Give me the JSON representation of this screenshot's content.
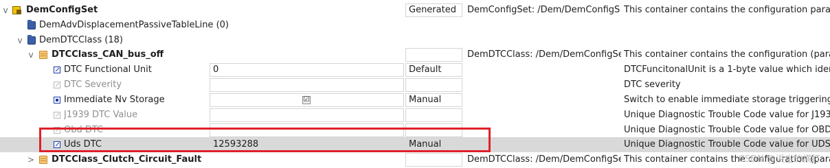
{
  "colors": {
    "selected_row_bg": "#d9d9d9",
    "highlight_border": "#e0202a",
    "param_icon": "#1a3aa8"
  },
  "rows": [
    {
      "label": "DemConfigSet",
      "value": "",
      "option": "Generated",
      "path": "DemConfigSet:  /Dem/DemConfigS",
      "description": "This container contains the configuration param",
      "icon": "config-set-icon",
      "expanded": "v"
    },
    {
      "label": "DemAdvDisplacementPassiveTableLine (0)",
      "icon": "folder-icon"
    },
    {
      "label": "DemDTCClass (18)",
      "icon": "folder-icon",
      "expanded": "v"
    },
    {
      "label": "DTCClass_CAN_bus_off",
      "value": "",
      "option": "",
      "path": "DemDTCClass:  /Dem/DemConfigSe",
      "description": "This container contains the configuration (param",
      "icon": "container-icon",
      "expanded": "v"
    },
    {
      "label": "DTC Functional Unit",
      "value": "0",
      "option": "Default",
      "description": "DTCFuncitonalUnit is a 1-byte value which ident",
      "icon": "parameter-icon"
    },
    {
      "label": "DTC Severity",
      "value": "",
      "option": "",
      "description": "DTC severity",
      "icon": "parameter-icon"
    },
    {
      "label": "Immediate Nv Storage",
      "value": "☑",
      "option": "Manual",
      "description": "Switch to enable immediate storage triggering",
      "icon": "boolean-parameter-icon"
    },
    {
      "label": "J1939 DTC Value",
      "value": "",
      "option": "",
      "description": "Unique Diagnostic Trouble Code value for J1939",
      "icon": "parameter-icon"
    },
    {
      "label": "Obd DTC",
      "value": "",
      "option": "",
      "description": "Unique Diagnostic Trouble Code value for OBD",
      "icon": "parameter-icon"
    },
    {
      "label": "Uds DTC",
      "value": "12593288",
      "option": "Manual",
      "description": "Unique Diagnostic Trouble Code value for UDS",
      "icon": "parameter-icon"
    },
    {
      "label": "DTCClass_Clutch_Circuit_Fault",
      "value": "",
      "option": "",
      "path": "DemDTCClass:  /Dem/DemConfigSe",
      "description": "This container contains the configuration (param",
      "icon": "container-icon",
      "expanded": ">"
    }
  ],
  "watermark": "CSDN @洪尘的横打"
}
